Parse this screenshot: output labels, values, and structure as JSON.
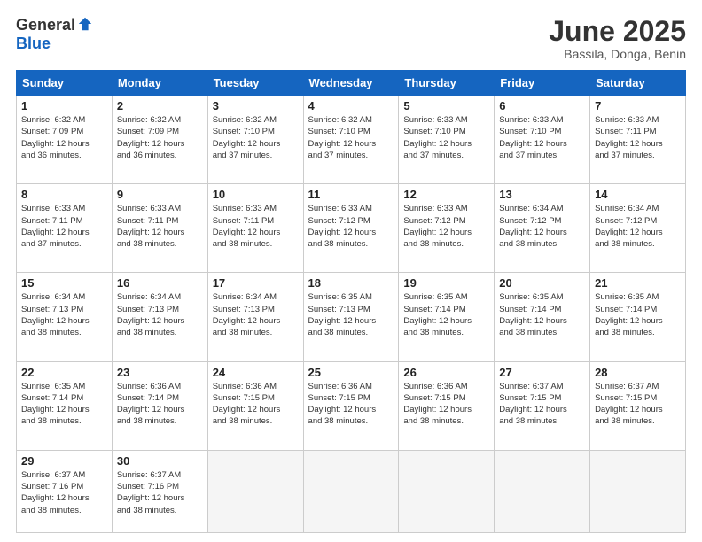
{
  "logo": {
    "general": "General",
    "blue": "Blue"
  },
  "title": "June 2025",
  "location": "Bassila, Donga, Benin",
  "headers": [
    "Sunday",
    "Monday",
    "Tuesday",
    "Wednesday",
    "Thursday",
    "Friday",
    "Saturday"
  ],
  "weeks": [
    [
      {
        "num": "1",
        "info": "Sunrise: 6:32 AM\nSunset: 7:09 PM\nDaylight: 12 hours\nand 36 minutes."
      },
      {
        "num": "2",
        "info": "Sunrise: 6:32 AM\nSunset: 7:09 PM\nDaylight: 12 hours\nand 36 minutes."
      },
      {
        "num": "3",
        "info": "Sunrise: 6:32 AM\nSunset: 7:10 PM\nDaylight: 12 hours\nand 37 minutes."
      },
      {
        "num": "4",
        "info": "Sunrise: 6:32 AM\nSunset: 7:10 PM\nDaylight: 12 hours\nand 37 minutes."
      },
      {
        "num": "5",
        "info": "Sunrise: 6:33 AM\nSunset: 7:10 PM\nDaylight: 12 hours\nand 37 minutes."
      },
      {
        "num": "6",
        "info": "Sunrise: 6:33 AM\nSunset: 7:10 PM\nDaylight: 12 hours\nand 37 minutes."
      },
      {
        "num": "7",
        "info": "Sunrise: 6:33 AM\nSunset: 7:11 PM\nDaylight: 12 hours\nand 37 minutes."
      }
    ],
    [
      {
        "num": "8",
        "info": "Sunrise: 6:33 AM\nSunset: 7:11 PM\nDaylight: 12 hours\nand 37 minutes."
      },
      {
        "num": "9",
        "info": "Sunrise: 6:33 AM\nSunset: 7:11 PM\nDaylight: 12 hours\nand 38 minutes."
      },
      {
        "num": "10",
        "info": "Sunrise: 6:33 AM\nSunset: 7:11 PM\nDaylight: 12 hours\nand 38 minutes."
      },
      {
        "num": "11",
        "info": "Sunrise: 6:33 AM\nSunset: 7:12 PM\nDaylight: 12 hours\nand 38 minutes."
      },
      {
        "num": "12",
        "info": "Sunrise: 6:33 AM\nSunset: 7:12 PM\nDaylight: 12 hours\nand 38 minutes."
      },
      {
        "num": "13",
        "info": "Sunrise: 6:34 AM\nSunset: 7:12 PM\nDaylight: 12 hours\nand 38 minutes."
      },
      {
        "num": "14",
        "info": "Sunrise: 6:34 AM\nSunset: 7:12 PM\nDaylight: 12 hours\nand 38 minutes."
      }
    ],
    [
      {
        "num": "15",
        "info": "Sunrise: 6:34 AM\nSunset: 7:13 PM\nDaylight: 12 hours\nand 38 minutes."
      },
      {
        "num": "16",
        "info": "Sunrise: 6:34 AM\nSunset: 7:13 PM\nDaylight: 12 hours\nand 38 minutes."
      },
      {
        "num": "17",
        "info": "Sunrise: 6:34 AM\nSunset: 7:13 PM\nDaylight: 12 hours\nand 38 minutes."
      },
      {
        "num": "18",
        "info": "Sunrise: 6:35 AM\nSunset: 7:13 PM\nDaylight: 12 hours\nand 38 minutes."
      },
      {
        "num": "19",
        "info": "Sunrise: 6:35 AM\nSunset: 7:14 PM\nDaylight: 12 hours\nand 38 minutes."
      },
      {
        "num": "20",
        "info": "Sunrise: 6:35 AM\nSunset: 7:14 PM\nDaylight: 12 hours\nand 38 minutes."
      },
      {
        "num": "21",
        "info": "Sunrise: 6:35 AM\nSunset: 7:14 PM\nDaylight: 12 hours\nand 38 minutes."
      }
    ],
    [
      {
        "num": "22",
        "info": "Sunrise: 6:35 AM\nSunset: 7:14 PM\nDaylight: 12 hours\nand 38 minutes."
      },
      {
        "num": "23",
        "info": "Sunrise: 6:36 AM\nSunset: 7:14 PM\nDaylight: 12 hours\nand 38 minutes."
      },
      {
        "num": "24",
        "info": "Sunrise: 6:36 AM\nSunset: 7:15 PM\nDaylight: 12 hours\nand 38 minutes."
      },
      {
        "num": "25",
        "info": "Sunrise: 6:36 AM\nSunset: 7:15 PM\nDaylight: 12 hours\nand 38 minutes."
      },
      {
        "num": "26",
        "info": "Sunrise: 6:36 AM\nSunset: 7:15 PM\nDaylight: 12 hours\nand 38 minutes."
      },
      {
        "num": "27",
        "info": "Sunrise: 6:37 AM\nSunset: 7:15 PM\nDaylight: 12 hours\nand 38 minutes."
      },
      {
        "num": "28",
        "info": "Sunrise: 6:37 AM\nSunset: 7:15 PM\nDaylight: 12 hours\nand 38 minutes."
      }
    ],
    [
      {
        "num": "29",
        "info": "Sunrise: 6:37 AM\nSunset: 7:16 PM\nDaylight: 12 hours\nand 38 minutes."
      },
      {
        "num": "30",
        "info": "Sunrise: 6:37 AM\nSunset: 7:16 PM\nDaylight: 12 hours\nand 38 minutes."
      },
      {
        "num": "",
        "info": ""
      },
      {
        "num": "",
        "info": ""
      },
      {
        "num": "",
        "info": ""
      },
      {
        "num": "",
        "info": ""
      },
      {
        "num": "",
        "info": ""
      }
    ]
  ]
}
